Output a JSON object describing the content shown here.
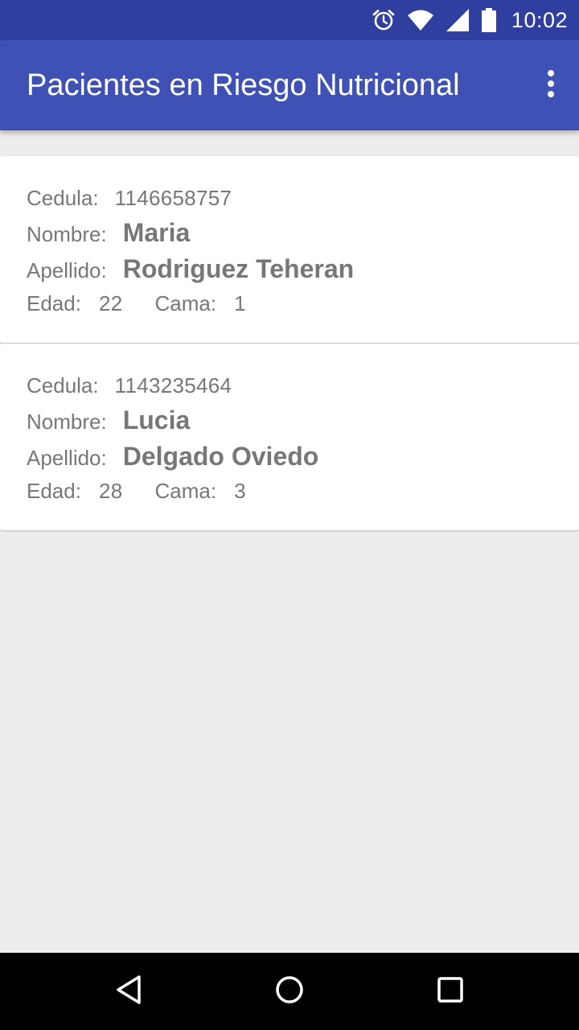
{
  "status_bar": {
    "time": "10:02",
    "icons": [
      "alarm-icon",
      "wifi-icon",
      "signal-icon",
      "battery-icon"
    ]
  },
  "app_bar": {
    "title": "Pacientes en Riesgo Nutricional",
    "menu_icon": "overflow-menu-icon"
  },
  "labels": {
    "cedula": "Cedula:",
    "nombre": "Nombre:",
    "apellido": "Apellido:",
    "edad": "Edad:",
    "cama": "Cama:"
  },
  "patients": [
    {
      "cedula": "1146658757",
      "nombre": "Maria",
      "apellido": "Rodriguez Teheran",
      "edad": "22",
      "cama": "1"
    },
    {
      "cedula": "1143235464",
      "nombre": "Lucia",
      "apellido": "Delgado Oviedo",
      "edad": "28",
      "cama": "3"
    }
  ],
  "nav_bar": {
    "icons": [
      "back-icon",
      "home-icon",
      "recents-icon"
    ]
  },
  "colors": {
    "status_bar": "#303f9f",
    "app_bar": "#3f51b5",
    "background": "#ededed",
    "card": "#ffffff",
    "text": "#777777"
  }
}
